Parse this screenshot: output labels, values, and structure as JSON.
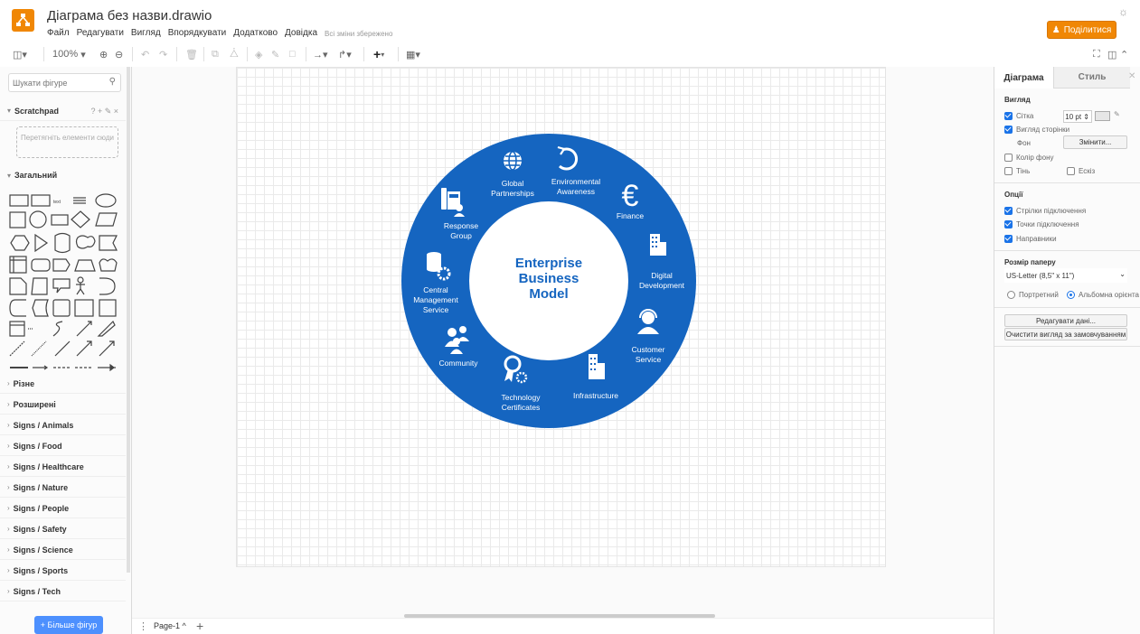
{
  "header": {
    "doc_title": "Діаграма без назви.drawio",
    "menu": [
      "Файл",
      "Редагувати",
      "Вигляд",
      "Впорядкувати",
      "Додатково",
      "Довідка"
    ],
    "saved_status": "Всі зміни збережено",
    "share_label": "Поділитися"
  },
  "toolbar": {
    "zoom": "100%"
  },
  "left_panel": {
    "search_placeholder": "Шукати фігуре",
    "scratchpad_title": "Scratchpad",
    "scratchpad_tools": "? + ✎ ×",
    "drop_hint": "Перетягніть елементи сюди",
    "general_title": "Загальний",
    "libraries": [
      "Різне",
      "Розширені",
      "Signs / Animals",
      "Signs / Food",
      "Signs / Healthcare",
      "Signs / Nature",
      "Signs / People",
      "Signs / Safety",
      "Signs / Science",
      "Signs / Sports",
      "Signs / Tech"
    ],
    "more_shapes": "+ Більше фігур"
  },
  "diagram": {
    "center_line1": "Enterprise",
    "center_line2": "Business",
    "center_line3": "Model",
    "ring_color": "#1565c0",
    "segments": [
      {
        "line1": "Global",
        "line2": "Partnerships",
        "icon": "globe-icon"
      },
      {
        "line1": "Environmental",
        "line2": "Awareness",
        "icon": "recycle-icon"
      },
      {
        "line1": "Finance",
        "line2": "",
        "icon": "euro-icon"
      },
      {
        "line1": "Digital",
        "line2": "Development",
        "icon": "office-building-icon"
      },
      {
        "line1": "Customer",
        "line2": "Service",
        "icon": "support-agent-icon"
      },
      {
        "line1": "Infrastructure",
        "line2": "",
        "icon": "buildings-icon"
      },
      {
        "line1": "Technology",
        "line2": "Certificates",
        "icon": "certificate-icon"
      },
      {
        "line1": "Community",
        "line2": "",
        "icon": "community-icon"
      },
      {
        "line1": "Central",
        "line2": "Management",
        "line3": "Service",
        "icon": "database-gear-icon"
      },
      {
        "line1": "Response",
        "line2": "Group",
        "icon": "phone-group-icon"
      }
    ]
  },
  "bottom": {
    "page_tab": "Page-1 ^",
    "add_page": "+"
  },
  "right_panel": {
    "tab_diagram": "Діаграма",
    "tab_style": "Стиль",
    "view_title": "Вигляд",
    "grid_label": "Сітка",
    "grid_size": "10 pt",
    "page_view_label": "Вигляд сторінки",
    "background_label": "Фон",
    "change_btn": "Змінити...",
    "bg_color_label": "Колір фону",
    "shadow_label": "Тінь",
    "sketch_label": "Ескіз",
    "options_title": "Опції",
    "opt_arrows": "Стрілки підключення",
    "opt_points": "Точки підключення",
    "opt_guides": "Направники",
    "paper_title": "Розмір паперу",
    "paper_value": "US-Letter (8,5\" x 11\")",
    "portrait_label": "Портретний",
    "landscape_label": "Альбомна орієнта",
    "edit_data_btn": "Редагувати дані...",
    "reset_view_btn": "Очистити вигляд за замовчуванням"
  }
}
